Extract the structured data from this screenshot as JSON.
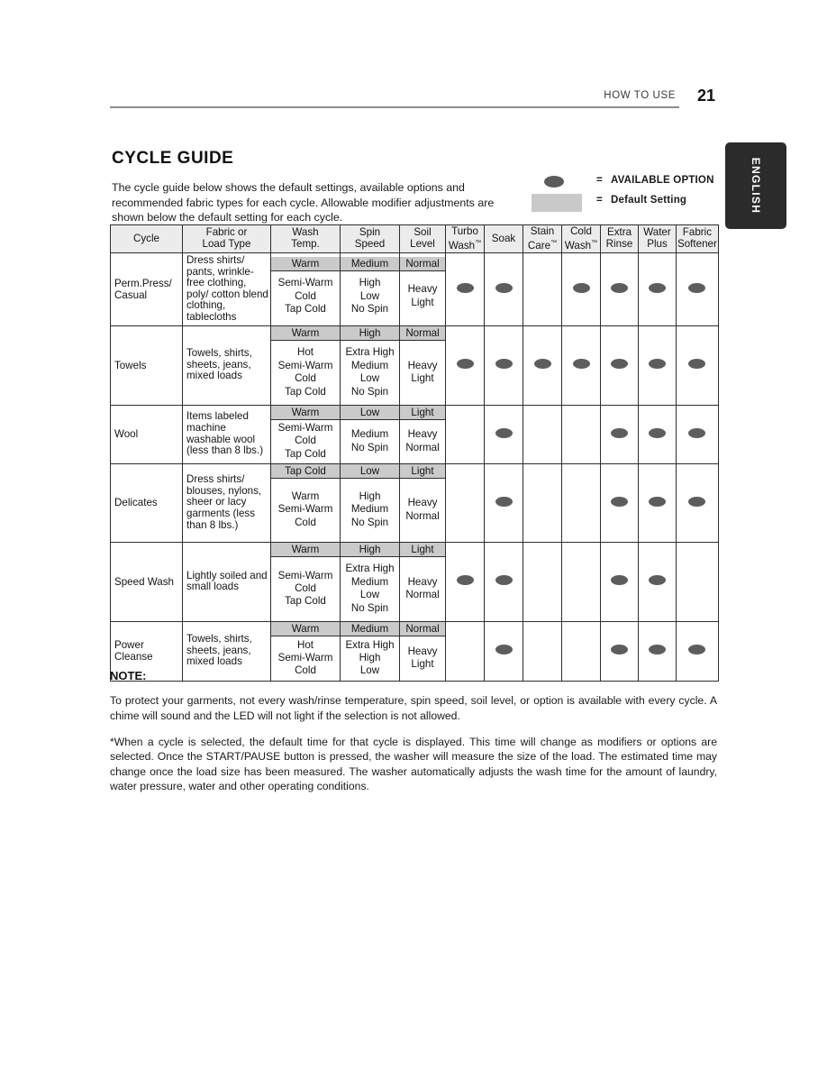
{
  "header": {
    "chapter": "HOW TO USE",
    "page_number": "21",
    "language_tab": "ENGLISH"
  },
  "section": {
    "title": "CYCLE GUIDE",
    "intro": "The cycle guide below shows the default settings, available options and recommended fabric types for each cycle. Allowable modifier adjustments are shown below the default setting for each cycle."
  },
  "legend": {
    "equals": "=",
    "rows": [
      {
        "symbol": "dot",
        "label": "AVAILABLE OPTION"
      },
      {
        "symbol": "swatch",
        "label": "Default Setting"
      }
    ],
    "dot_color": "#5b5b5b",
    "swatch_color": "#c9c9c9"
  },
  "table": {
    "headers": {
      "cycle": {
        "line1": "Cycle",
        "line2": ""
      },
      "fabric": {
        "line1": "Fabric or",
        "line2": "Load Type"
      },
      "wash_temp": {
        "line1": "Wash",
        "line2": "Temp."
      },
      "spin_speed": {
        "line1": "Spin",
        "line2": "Speed"
      },
      "soil_level": {
        "line1": "Soil",
        "line2": "Level"
      },
      "options": [
        {
          "line1": "Turbo",
          "line2": "Wash",
          "tm": "™"
        },
        {
          "line1": "Soak",
          "line2": "",
          "tm": ""
        },
        {
          "line1": "Stain",
          "line2": "Care",
          "tm": "™"
        },
        {
          "line1": "Cold",
          "line2": "Wash",
          "tm": "™"
        },
        {
          "line1": "Extra",
          "line2": "Rinse",
          "tm": ""
        },
        {
          "line1": "Water",
          "line2": "Plus",
          "tm": ""
        },
        {
          "line1": "Fabric",
          "line2": "Softener",
          "tm": ""
        }
      ]
    },
    "rows": [
      {
        "cycle": "Perm.Press/\nCasual",
        "fabric": "Dress shirts/ pants, wrinkle-free clothing, poly/ cotton blend clothing, tablecloths",
        "wash_temp": {
          "default": "Warm",
          "alts": [
            "Semi-Warm",
            "Cold",
            "Tap Cold"
          ]
        },
        "spin_speed": {
          "default": "Medium",
          "alts": [
            "High",
            "Low",
            "No Spin"
          ]
        },
        "soil_level": {
          "default": "Normal",
          "alts": [
            "Heavy",
            "Light"
          ]
        },
        "options": [
          true,
          true,
          false,
          true,
          true,
          true,
          true
        ]
      },
      {
        "cycle": "Towels",
        "fabric": "Towels, shirts, sheets, jeans, mixed loads",
        "wash_temp": {
          "default": "Warm",
          "alts": [
            "Hot",
            "Semi-Warm",
            "Cold",
            "Tap Cold"
          ]
        },
        "spin_speed": {
          "default": "High",
          "alts": [
            "Extra High",
            "Medium",
            "Low",
            "No Spin"
          ]
        },
        "soil_level": {
          "default": "Normal",
          "alts": [
            "Heavy",
            "Light"
          ]
        },
        "options": [
          true,
          true,
          true,
          true,
          true,
          true,
          true
        ]
      },
      {
        "cycle": "Wool",
        "fabric": "Items labeled machine washable wool (less than 8 lbs.)",
        "wash_temp": {
          "default": "Warm",
          "alts": [
            "Semi-Warm",
            "Cold",
            "Tap Cold"
          ]
        },
        "spin_speed": {
          "default": "Low",
          "alts": [
            "Medium",
            "No Spin"
          ]
        },
        "soil_level": {
          "default": "Light",
          "alts": [
            "Heavy",
            "Normal"
          ]
        },
        "options": [
          false,
          true,
          false,
          false,
          true,
          true,
          true
        ]
      },
      {
        "cycle": "Delicates",
        "fabric": "Dress shirts/ blouses, nylons, sheer or lacy garments (less than 8 lbs.)",
        "wash_temp": {
          "default": "Tap Cold",
          "alts": [
            "Warm",
            "Semi-Warm",
            "Cold"
          ]
        },
        "spin_speed": {
          "default": "Low",
          "alts": [
            "High",
            "Medium",
            "No Spin"
          ]
        },
        "soil_level": {
          "default": "Light",
          "alts": [
            "Heavy",
            "Normal"
          ]
        },
        "options": [
          false,
          true,
          false,
          false,
          true,
          true,
          true
        ]
      },
      {
        "cycle": "Speed Wash",
        "fabric": "Lightly soiled and small loads",
        "wash_temp": {
          "default": "Warm",
          "alts": [
            "Semi-Warm",
            "Cold",
            "Tap Cold"
          ]
        },
        "spin_speed": {
          "default": "High",
          "alts": [
            "Extra High",
            "Medium",
            "Low",
            "No Spin"
          ]
        },
        "soil_level": {
          "default": "Light",
          "alts": [
            "Heavy",
            "Normal"
          ]
        },
        "options": [
          true,
          true,
          false,
          false,
          true,
          true,
          false
        ]
      },
      {
        "cycle": "Power\nCleanse",
        "fabric": "Towels, shirts, sheets, jeans, mixed loads",
        "wash_temp": {
          "default": "Warm",
          "alts": [
            "Hot",
            "Semi-Warm",
            "Cold"
          ]
        },
        "spin_speed": {
          "default": "Medium",
          "alts": [
            "Extra High",
            "High",
            "Low"
          ]
        },
        "soil_level": {
          "default": "Normal",
          "alts": [
            "Heavy",
            "Light"
          ]
        },
        "options": [
          false,
          true,
          false,
          false,
          true,
          true,
          true
        ]
      }
    ]
  },
  "note": {
    "title": "NOTE:",
    "paragraphs": [
      "To protect your garments, not every wash/rinse temperature, spin speed, soil level, or option is available with every cycle. A chime will sound and the LED will not light if the selection is not allowed.",
      "*When a cycle is selected, the default time for that cycle is displayed. This time will change as modifiers or options are selected. Once the START/PAUSE button is pressed, the washer will measure the size of the load. The estimated time may change once the load size has been measured. The washer automatically adjusts the wash time for the amount of laundry, water pressure, water and other operating conditions."
    ]
  }
}
